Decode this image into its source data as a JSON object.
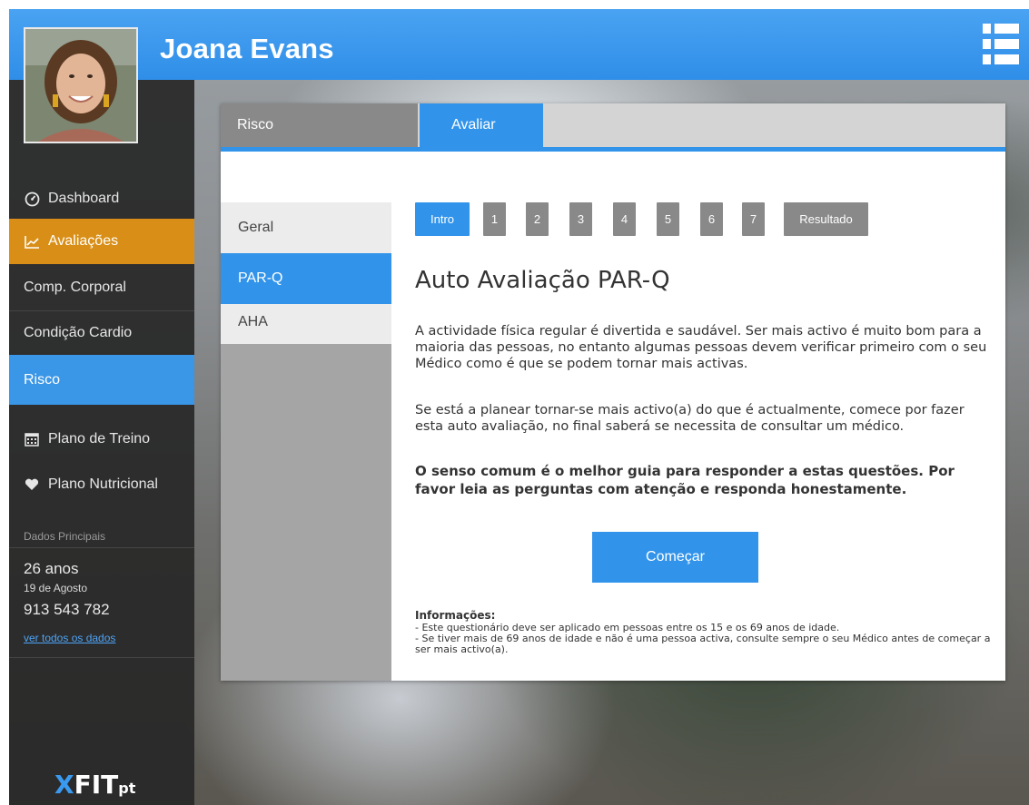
{
  "header": {
    "user_name": "Joana Evans",
    "menu_icon": "list-menu-icon"
  },
  "sidebar": {
    "items": [
      {
        "label": "Dashboard",
        "icon": "speedometer-icon"
      },
      {
        "label": "Avaliações",
        "icon": "chart-line-icon"
      },
      {
        "label": "Comp. Corporal"
      },
      {
        "label": "Condição Cardio"
      },
      {
        "label": "Risco"
      },
      {
        "label": "Plano de Treino",
        "icon": "calendar-icon"
      },
      {
        "label": "Plano Nutricional",
        "icon": "heart-icon"
      }
    ],
    "section_title": "Dados Principais",
    "age": "26 anos",
    "birthday": "19 de Agosto",
    "phone": "913 543 782",
    "all_data_link": "ver todos os dados",
    "logo": {
      "x": "X",
      "fit": "FIT",
      "pt": "pt"
    }
  },
  "tabs": [
    {
      "label": "Risco"
    },
    {
      "label": "Avaliar"
    }
  ],
  "left_nav": [
    {
      "label": "Geral"
    },
    {
      "label": "PAR-Q"
    },
    {
      "label": "AHA"
    }
  ],
  "steps": [
    "Intro",
    "1",
    "2",
    "3",
    "4",
    "5",
    "6",
    "7",
    "Resultado"
  ],
  "content": {
    "title": "Auto Avaliação PAR-Q",
    "paragraph1": "A actividade física regular é divertida e saudável. Ser mais activo é muito bom para a maioria das pessoas, no entanto algumas pessoas devem verificar primeiro com o seu Médico como é que se podem tornar mais activas.",
    "paragraph2": "Se está a planear tornar-se mais activo(a) do que é actualmente, comece por fazer esta auto avaliação, no final saberá se necessita de consultar um médico.",
    "paragraph3": "O senso comum é o melhor guia para responder a estas questões. Por favor leia as perguntas com atenção e responda honestamente.",
    "start_button": "Começar",
    "info_title": "Informações:",
    "info_line1": "- Este questionário deve ser aplicado em pessoas entre os 15 e os 69 anos de idade.",
    "info_line2": "- Se tiver mais de 69 anos de idade e não é uma pessoa activa, consulte sempre o seu Médico antes de começar a ser mais activo(a)."
  },
  "colors": {
    "accent_blue": "#3194ea",
    "accent_orange": "#d98f17",
    "sidebar_bg": "#282828",
    "tab_gray": "#898989"
  }
}
